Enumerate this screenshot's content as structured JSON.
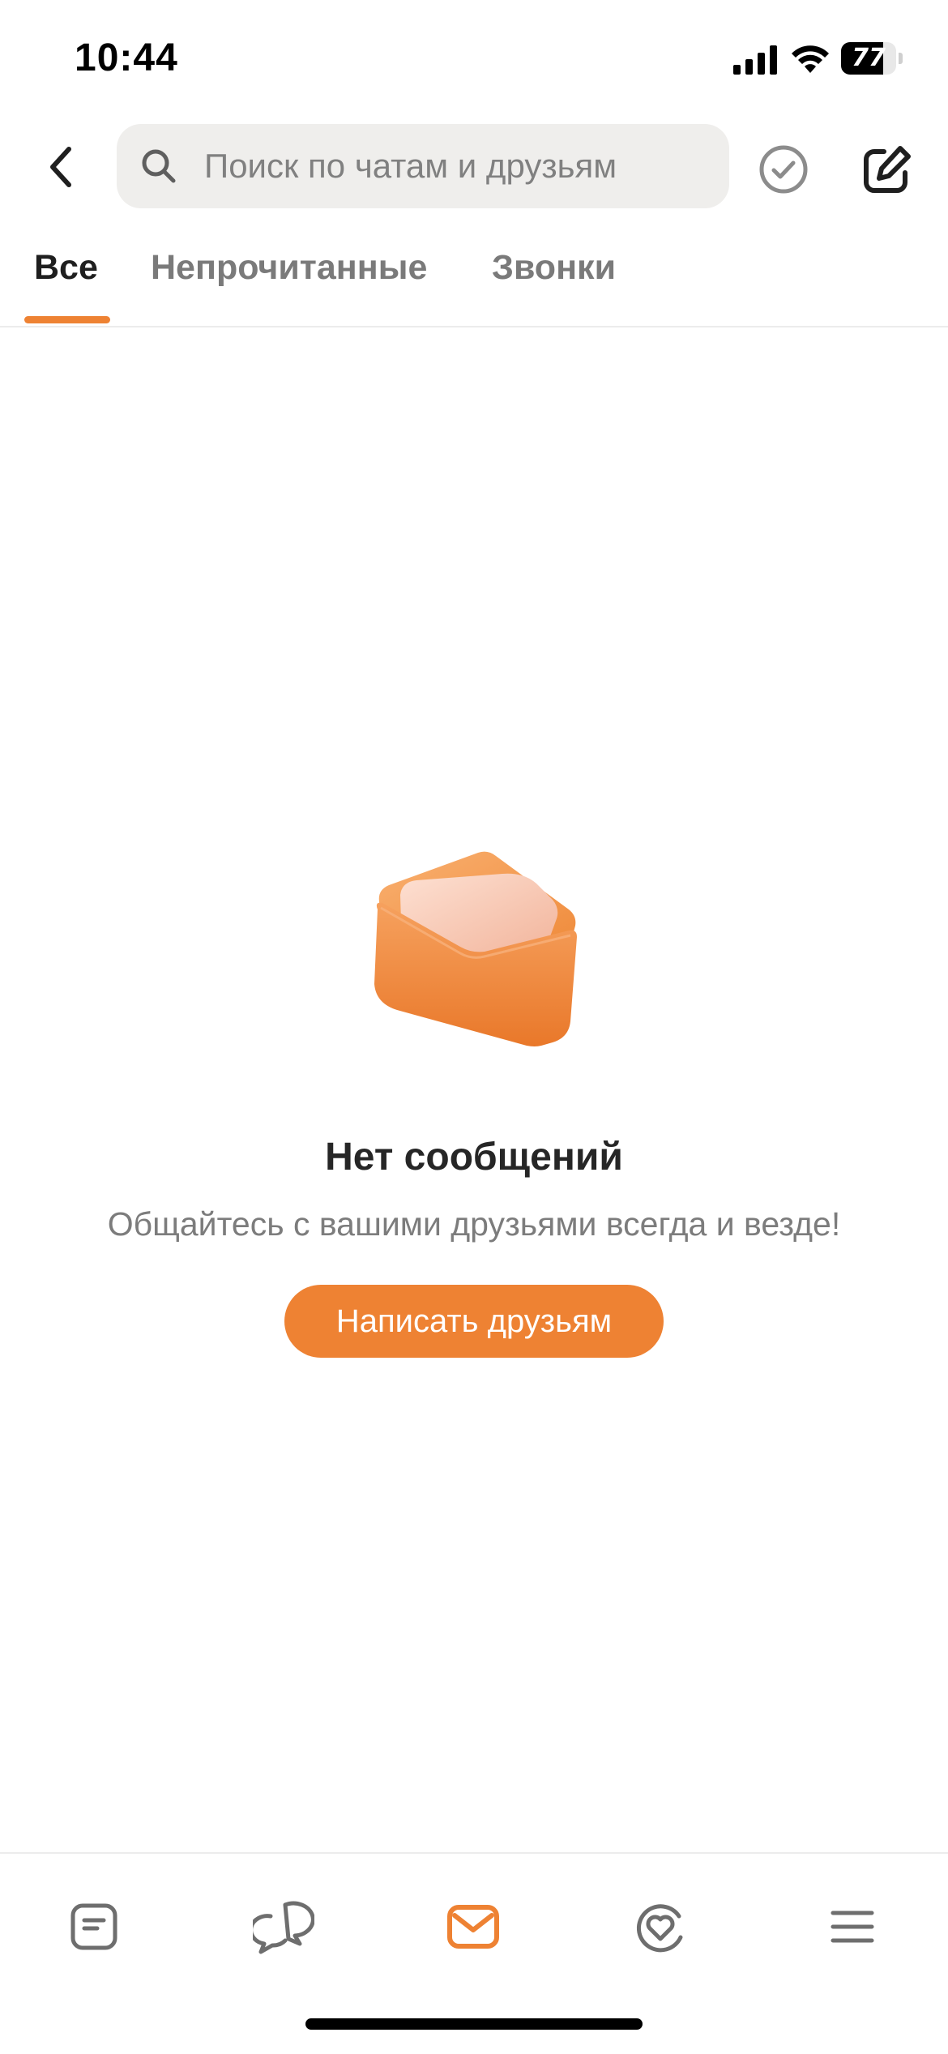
{
  "status_bar": {
    "time": "10:44",
    "battery_level": "77",
    "battery_fraction": 0.77
  },
  "header": {
    "search_placeholder": "Поиск по чатам и друзьям",
    "search_value": ""
  },
  "tabs": [
    {
      "label": "Все",
      "active": true
    },
    {
      "label": "Непрочитанные",
      "active": false
    },
    {
      "label": "Звонки",
      "active": false
    }
  ],
  "empty_state": {
    "title": "Нет сообщений",
    "subtitle": "Общайтесь с вашими друзьями всегда и везде!",
    "button_label": "Написать друзьям"
  },
  "bottom_nav": {
    "active_item": "messages",
    "items": [
      "feed-icon",
      "discussions-icon",
      "messages-icon",
      "dating-icon",
      "menu-icon"
    ]
  },
  "colors": {
    "accent": "#ee8233",
    "text_primary": "#1f1f1f",
    "text_secondary": "#7a7a7a",
    "icon_gray": "#6e6e6e"
  }
}
